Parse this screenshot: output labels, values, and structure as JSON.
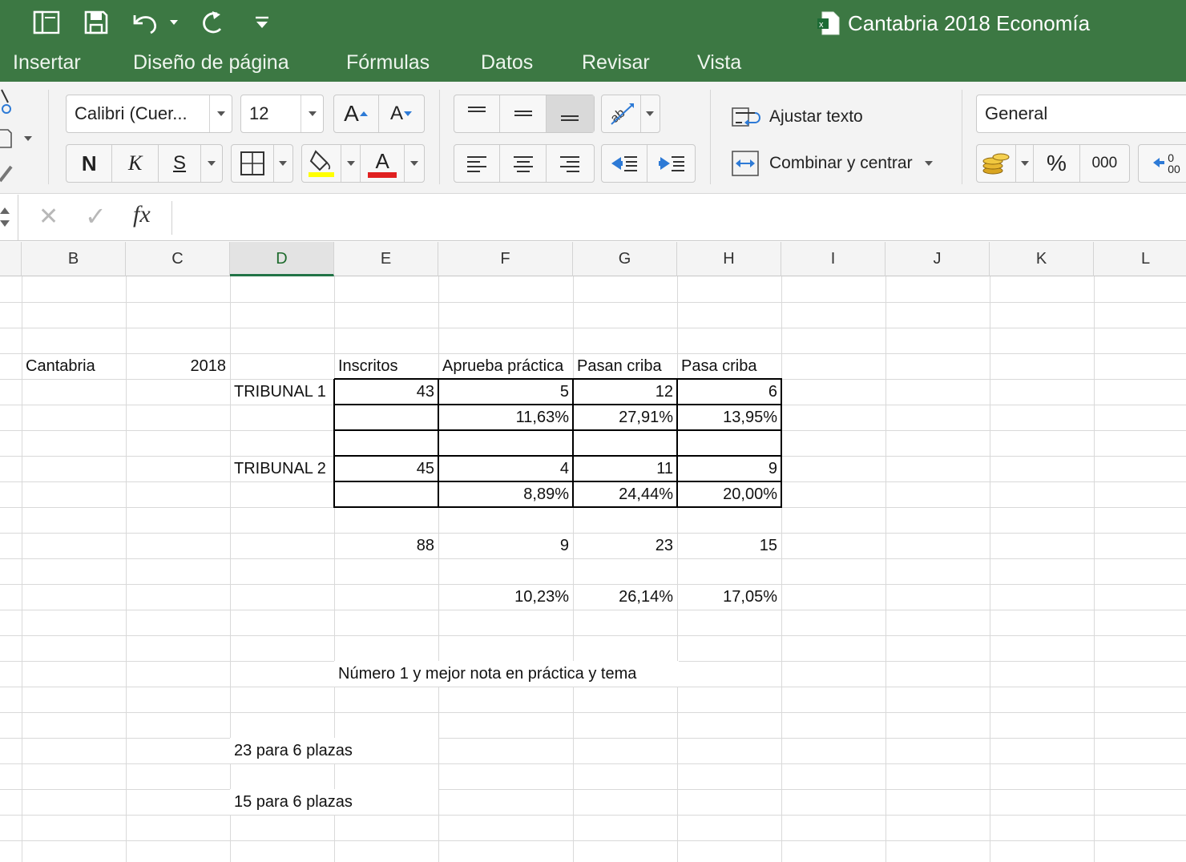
{
  "window": {
    "title": "Cantabria 2018 Economía"
  },
  "tabs": [
    "Insertar",
    "Diseño de página",
    "Fórmulas",
    "Datos",
    "Revisar",
    "Vista"
  ],
  "ribbon": {
    "font_name": "Calibri (Cuer...",
    "font_size": "12",
    "grow_font": "A",
    "shrink_font": "A",
    "bold": "N",
    "italic": "K",
    "underline": "S",
    "font_color_letter": "A",
    "wrap_text": "Ajustar texto",
    "merge_center": "Combinar y centrar",
    "number_format": "General",
    "percent": "%",
    "thousands": "000",
    "decimals_top": "0",
    "decimals_bottom": "00"
  },
  "formula_bar": {
    "cancel": "✕",
    "confirm": "✓",
    "fx": "fx",
    "value": ""
  },
  "columns": [
    "B",
    "C",
    "D",
    "E",
    "F",
    "G",
    "H",
    "I",
    "J",
    "K",
    "L"
  ],
  "selected_column": "D",
  "sheet": {
    "r4": {
      "b": "Cantabria",
      "c": "2018",
      "e": "Inscritos",
      "f": "Aprueba práctica",
      "g": "Pasan criba",
      "h": "Pasa criba"
    },
    "r5": {
      "d": "TRIBUNAL 1",
      "e": "43",
      "f": "5",
      "g": "12",
      "h": "6"
    },
    "r6": {
      "f": "11,63%",
      "g": "27,91%",
      "h": "13,95%"
    },
    "r8": {
      "d": "TRIBUNAL 2",
      "e": "45",
      "f": "4",
      "g": "11",
      "h": "9"
    },
    "r9": {
      "f": "8,89%",
      "g": "24,44%",
      "h": "20,00%"
    },
    "r11": {
      "e": "88",
      "f": "9",
      "g": "23",
      "h": "15"
    },
    "r13": {
      "f": "10,23%",
      "g": "26,14%",
      "h": "17,05%"
    },
    "r16": {
      "e": "Número 1 y mejor nota en práctica y tema"
    },
    "r19": {
      "d": "23 para 6 plazas"
    },
    "r21": {
      "d": "15 para 6 plazas"
    }
  },
  "colors": {
    "title_bar": "#3c7843",
    "ribbon": "#f3f3f3",
    "grid_line": "#d9d9d9",
    "selected_col": "#217346",
    "fill_yellow": "#ffff00",
    "font_red": "#e02020"
  }
}
